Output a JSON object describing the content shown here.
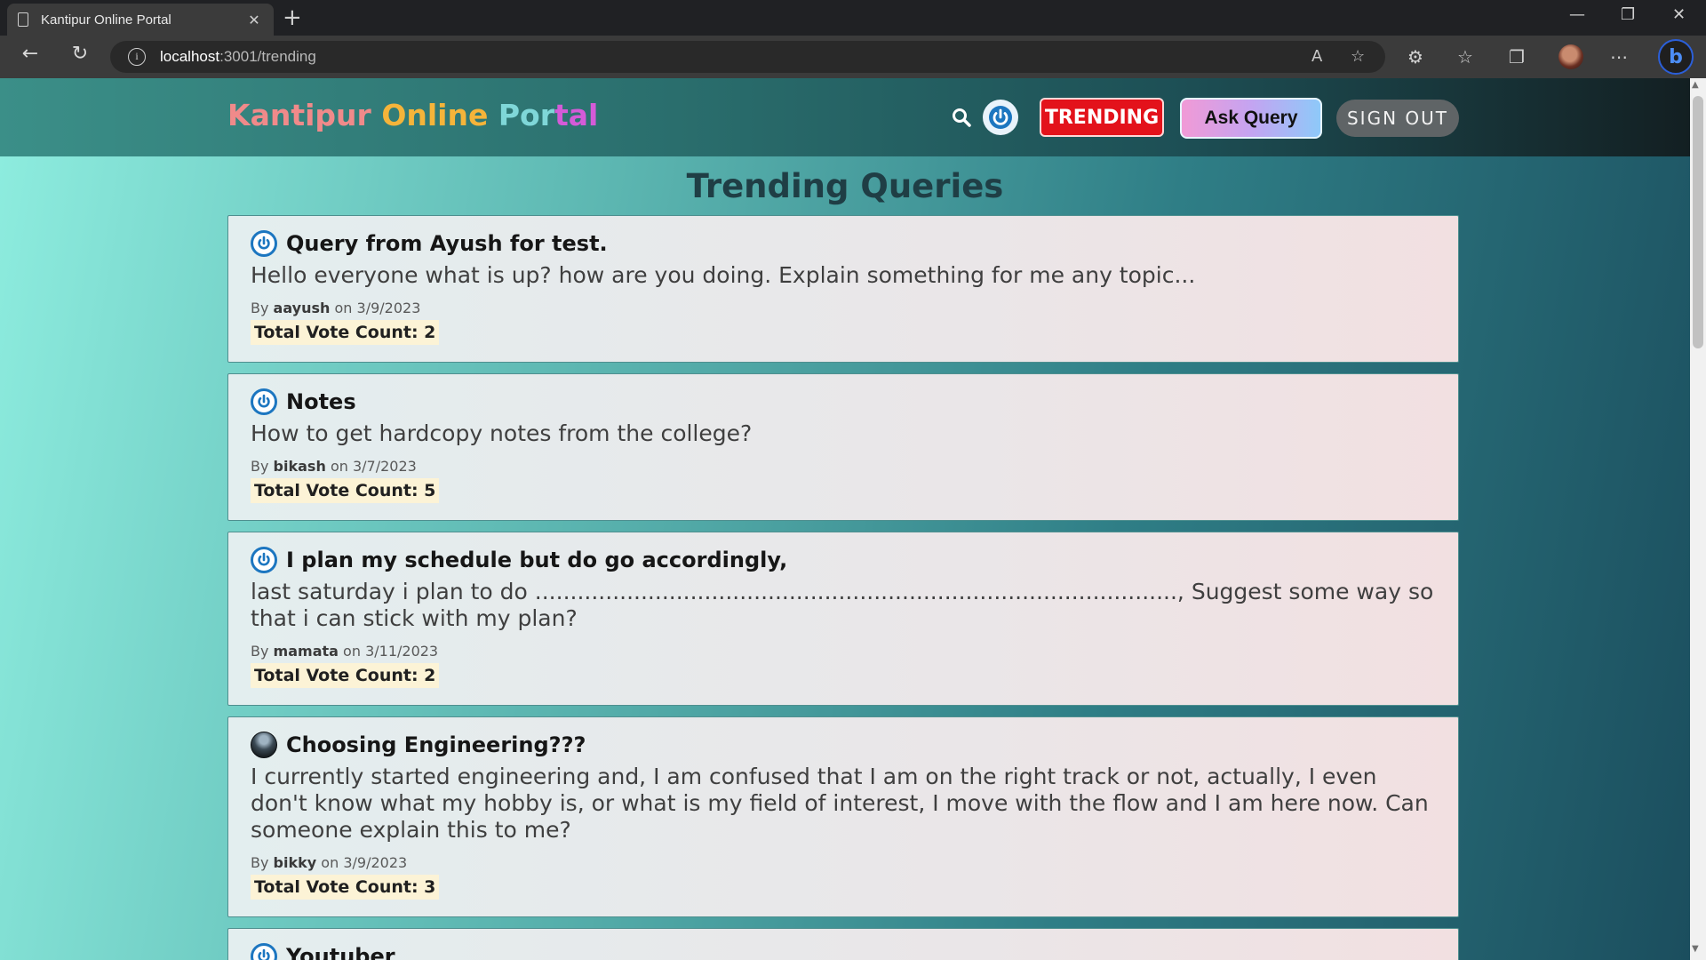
{
  "browser": {
    "tab_title": "Kantipur Online Portal",
    "tab_close": "✕",
    "new_tab": "+",
    "url_host": "localhost",
    "url_path": ":3001/trending",
    "window_controls": {
      "minimize": "—",
      "restore": "❐",
      "close": "✕"
    }
  },
  "header": {
    "brand_parts": [
      "Kantipur",
      "Online",
      "Por",
      "tal"
    ],
    "trending_label": "TRENDING",
    "ask_label": "Ask Query",
    "signout_label": "SIGN OUT"
  },
  "page": {
    "title": "Trending Queries"
  },
  "queries": [
    {
      "icon": "power-icon",
      "title": "Query from Ayush for test.",
      "body": "Hello everyone what is up? how are you doing. Explain something for me any topic...",
      "by_prefix": "By",
      "author": "aayush",
      "date_prefix": "on",
      "date": "3/9/2023",
      "vote_text": "Total Vote Count: 2"
    },
    {
      "icon": "power-icon",
      "title": "Notes",
      "body": "How to get hardcopy notes from the college?",
      "by_prefix": "By",
      "author": "bikash",
      "date_prefix": "on",
      "date": "3/7/2023",
      "vote_text": "Total Vote Count: 5"
    },
    {
      "icon": "power-icon",
      "title": "I plan my schedule but do go accordingly,",
      "body": "last saturday i plan to do ..........................................................................................., Suggest some way so that i can stick with my plan?",
      "by_prefix": "By",
      "author": "mamata",
      "date_prefix": "on",
      "date": "3/11/2023",
      "vote_text": "Total Vote Count: 2"
    },
    {
      "icon": "user-photo-icon",
      "title": "Choosing Engineering???",
      "body": "I currently started engineering and, I am confused that I am on the right track or not, actually, I even don't know what my hobby is, or what is my field of interest, I move with the flow and I am here now. Can someone explain this to me?",
      "by_prefix": "By",
      "author": "bikky",
      "date_prefix": "on",
      "date": "3/9/2023",
      "vote_text": "Total Vote Count: 3"
    },
    {
      "icon": "power-icon",
      "title": "Youtuber"
    }
  ]
}
